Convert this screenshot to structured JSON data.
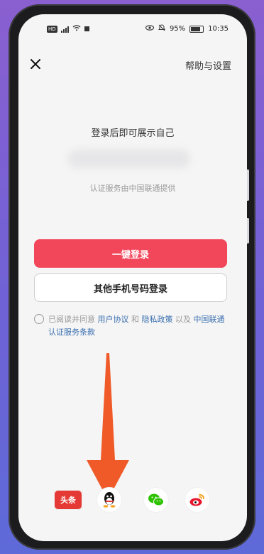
{
  "status_bar": {
    "hd": "HD",
    "battery": "95%",
    "time": "10:35"
  },
  "header": {
    "help_label": "帮助与设置"
  },
  "login": {
    "title": "登录后即可展示自己",
    "provider": "认证服务由中国联通提供",
    "primary_label": "一键登录",
    "secondary_label": "其他手机号码登录"
  },
  "agreement": {
    "prefix": "已阅读并同意",
    "user_agreement": "用户协议",
    "and": "和",
    "privacy_policy": "隐私政策",
    "and2": "以及",
    "carrier_terms": "中国联通认证服务条款"
  },
  "socials": {
    "toutiao_label": "头条"
  },
  "colors": {
    "accent": "#f2465a",
    "link": "#3a6fb0",
    "arrow": "#f05a28"
  }
}
